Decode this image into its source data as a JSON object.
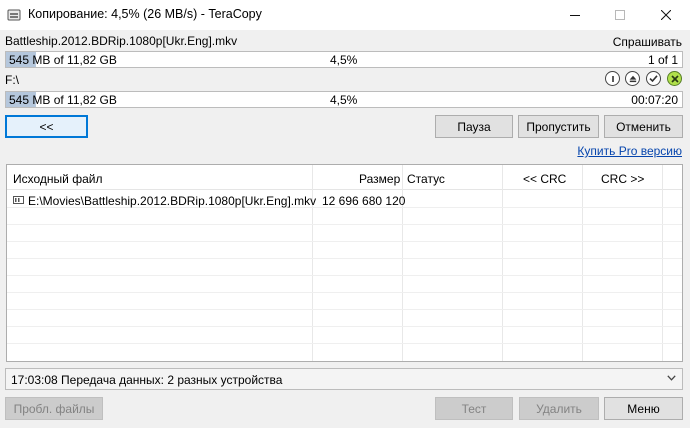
{
  "window": {
    "title": "Копирование: 4,5%  (26 MB/s) - TeraCopy"
  },
  "source": {
    "filename": "Battleship.2012.BDRip.1080p[Ukr.Eng].mkv",
    "ask_label": "Спрашивать",
    "progress": {
      "fraction": 0.045,
      "size_text": "545 MB of 11,82 GB",
      "percent_text": "4,5%",
      "count_text": "1 of 1"
    }
  },
  "destination": {
    "path": "F:\\",
    "progress": {
      "fraction": 0.045,
      "size_text": "545 MB of 11,82 GB",
      "percent_text": "4,5%",
      "time_text": "00:07:20"
    },
    "icons": [
      "info-icon",
      "eject-icon",
      "check-icon",
      "close-green-icon"
    ]
  },
  "buttons": {
    "back": "<<",
    "pause": "Пауза",
    "skip": "Пропустить",
    "cancel": "Отменить",
    "buy_pro": "Купить Pro версию",
    "probl": "Пробл. файлы",
    "test": "Тест",
    "delete": "Удалить",
    "menu": "Меню"
  },
  "table": {
    "columns": [
      "Исходный файл",
      "Размер",
      "Статус",
      "<< CRC",
      "CRC >>"
    ],
    "rows": [
      {
        "file": "E:\\Movies\\Battleship.2012.BDRip.1080p[Ukr.Eng].mkv",
        "size": "12 696 680 120",
        "status": "",
        "crc_src": "",
        "crc_dst": ""
      }
    ]
  },
  "status_bar": {
    "text": "17:03:08 Передача данных: 2 разных устройства"
  },
  "colors": {
    "progress_fill": "#b5c7dc",
    "link": "#0645ad",
    "focus_border": "#0078d7",
    "green_button": "#b0e04a"
  }
}
